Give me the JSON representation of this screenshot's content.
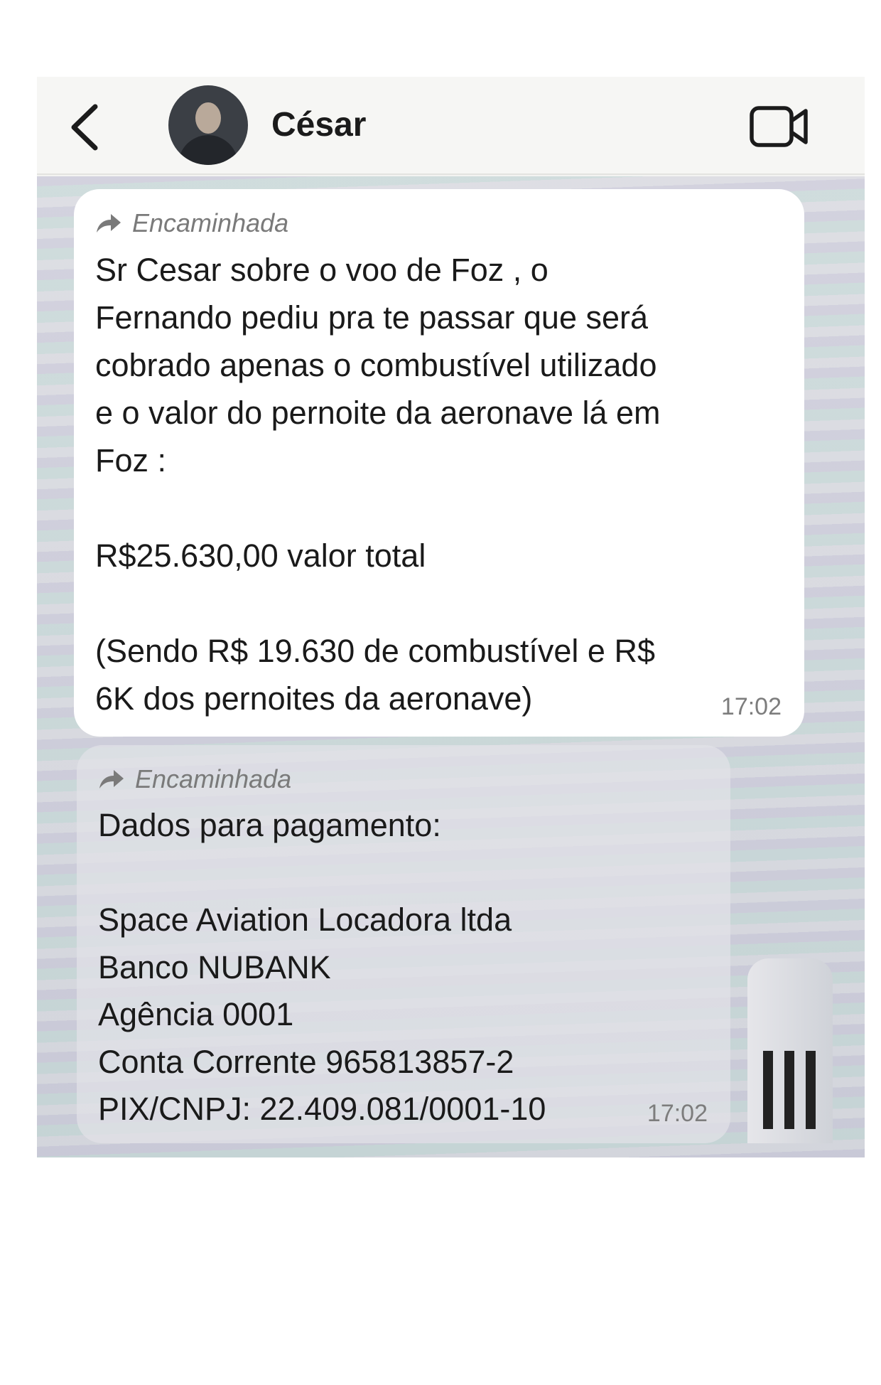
{
  "header": {
    "contact_name": "César",
    "back_icon": "chevron-left-icon",
    "video_icon": "video-camera-icon"
  },
  "messages": [
    {
      "forwarded_label": "Encaminhada",
      "text": "Sr Cesar sobre o voo de Foz , o\nFernando pediu pra te passar que será\ncobrado apenas o combustível utilizado\ne o valor do pernoite da aeronave lá em\nFoz :\n\nR$25.630,00 valor total\n\n(Sendo R$ 19.630 de combustível e R$\n6K dos pernoites da aeronave)",
      "time": "17:02"
    },
    {
      "forwarded_label": "Encaminhada",
      "text": "Dados para pagamento:\n\nSpace Aviation Locadora ltda\nBanco NUBANK\nAgência 0001\nConta Corrente 965813857-2\nPIX/CNPJ: 22.409.081/0001-10",
      "time": "17:02"
    }
  ],
  "colors": {
    "bubble_incoming": "#ffffff",
    "timestamp": "#7d7d7d",
    "forwarded": "#7a7a7a"
  }
}
